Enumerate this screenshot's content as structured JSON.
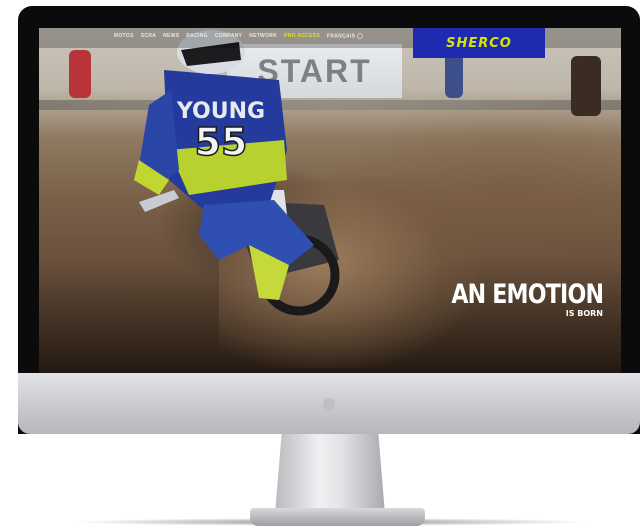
{
  "nav": {
    "items": [
      "MOTOS",
      "SCRA",
      "NEWS",
      "RACING",
      "COMPANY",
      "NETWORK"
    ],
    "pro_access": "PRO ACCESS",
    "language": "FRANÇAIS"
  },
  "brand": {
    "logo": "SHERCO",
    "color": "#1e2bb0",
    "logo_color": "#d7e600"
  },
  "banner": {
    "text": "START"
  },
  "rider": {
    "name": "YOUNG",
    "number": "55"
  },
  "hero": {
    "title": "AN EMOTION",
    "subtitle": "IS BORN"
  },
  "icons": {
    "language": "globe-icon",
    "device": "apple-logo-icon"
  }
}
